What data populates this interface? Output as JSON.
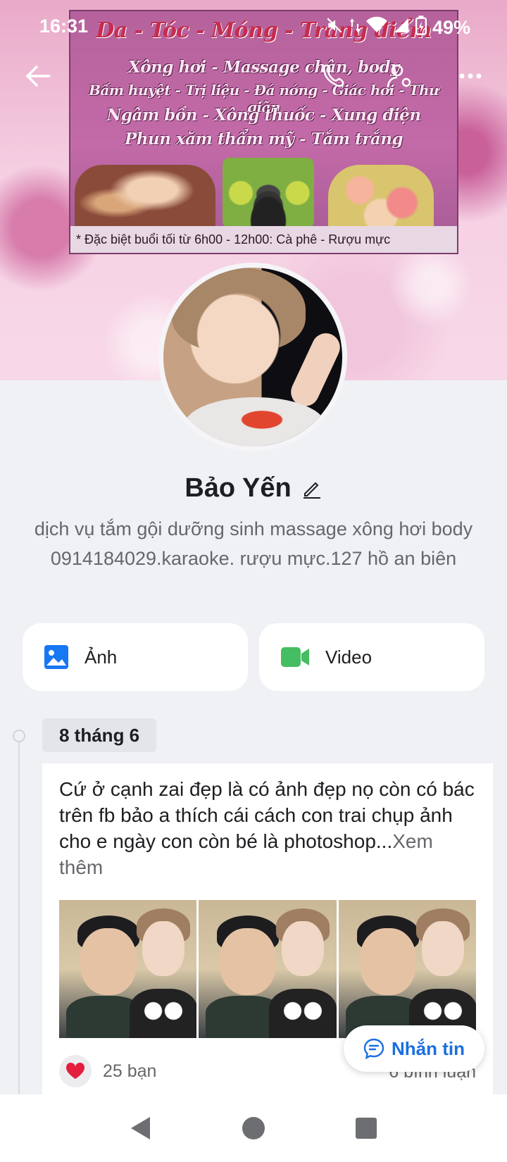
{
  "status_bar": {
    "time": "16:31",
    "battery": "49%"
  },
  "cover": {
    "banner_line1": "Da - Tóc - Móng - Trang điểm",
    "banner_line2": "Xông hơi - Massage chân, body",
    "banner_line3": "Bấm huyệt - Trị liệu - Đá nóng - Giác hơi - Thư giãn",
    "banner_line4": "Ngâm bồn - Xông thuốc - Xung điện",
    "banner_line5": "Phun xăm thẩm mỹ - Tắm trắng",
    "banner_footer": "* Đặc biệt buổi tối từ 6h00 - 12h00: Cà phê - Rượu mực"
  },
  "profile": {
    "name": "Bảo Yến",
    "bio": "dịch vụ tắm gội dưỡng sinh massage xông hơi body 0914184029.karaoke. rượu mực.127 hồ an biên"
  },
  "media_buttons": {
    "photos_label": "Ảnh",
    "video_label": "Video"
  },
  "timeline": {
    "date": "8 tháng 6"
  },
  "post": {
    "text": "Cứ ở cạnh zai đẹp là có ảnh đẹp nọ còn có bác trên fb bảo a thích cái cách con trai chụp ảnh cho e ngày con còn bé là photoshop...",
    "see_more": "Xem thêm",
    "reactions": "25 bạn",
    "comments": "6 bình luận",
    "photo_count": 3
  },
  "fab": {
    "label": "Nhắn tin"
  },
  "colors": {
    "accent": "#1a6fe0",
    "photo_icon": "#1877f2",
    "video_icon": "#45bd62",
    "heart": "#e41e3f"
  },
  "icons": [
    "back-arrow-icon",
    "phone-icon",
    "person-settings-icon",
    "more-dots-icon",
    "edit-pencil-icon",
    "photo-icon",
    "video-camera-icon",
    "heart-icon",
    "message-icon",
    "nav-back-icon",
    "nav-home-icon",
    "nav-recents-icon"
  ]
}
